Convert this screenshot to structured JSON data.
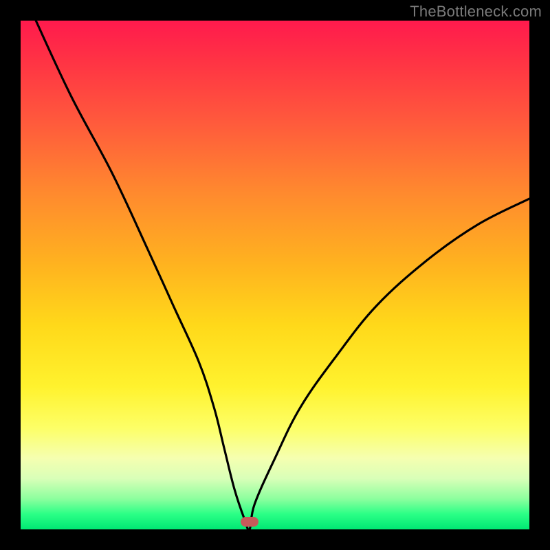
{
  "watermark": "TheBottleneck.com",
  "chart_data": {
    "type": "line",
    "title": "",
    "xlabel": "",
    "ylabel": "",
    "xlim": [
      0,
      100
    ],
    "ylim": [
      0,
      100
    ],
    "series": [
      {
        "name": "curve",
        "x": [
          3,
          10,
          18,
          25,
          30,
          35,
          38,
          40,
          42,
          44,
          45,
          46,
          50,
          55,
          62,
          70,
          80,
          90,
          100
        ],
        "y": [
          100,
          85,
          70,
          55,
          44,
          33,
          24,
          16,
          8,
          2,
          0,
          5,
          14,
          24,
          34,
          44,
          53,
          60,
          65
        ]
      }
    ],
    "marker": {
      "x": 45,
      "y": 1.5,
      "color": "#c65a5a"
    },
    "gradient_stops": [
      {
        "pos": 0.0,
        "color": "#ff1a4d"
      },
      {
        "pos": 0.5,
        "color": "#ffd91a"
      },
      {
        "pos": 0.88,
        "color": "#f5ffb0"
      },
      {
        "pos": 1.0,
        "color": "#00e873"
      }
    ]
  }
}
